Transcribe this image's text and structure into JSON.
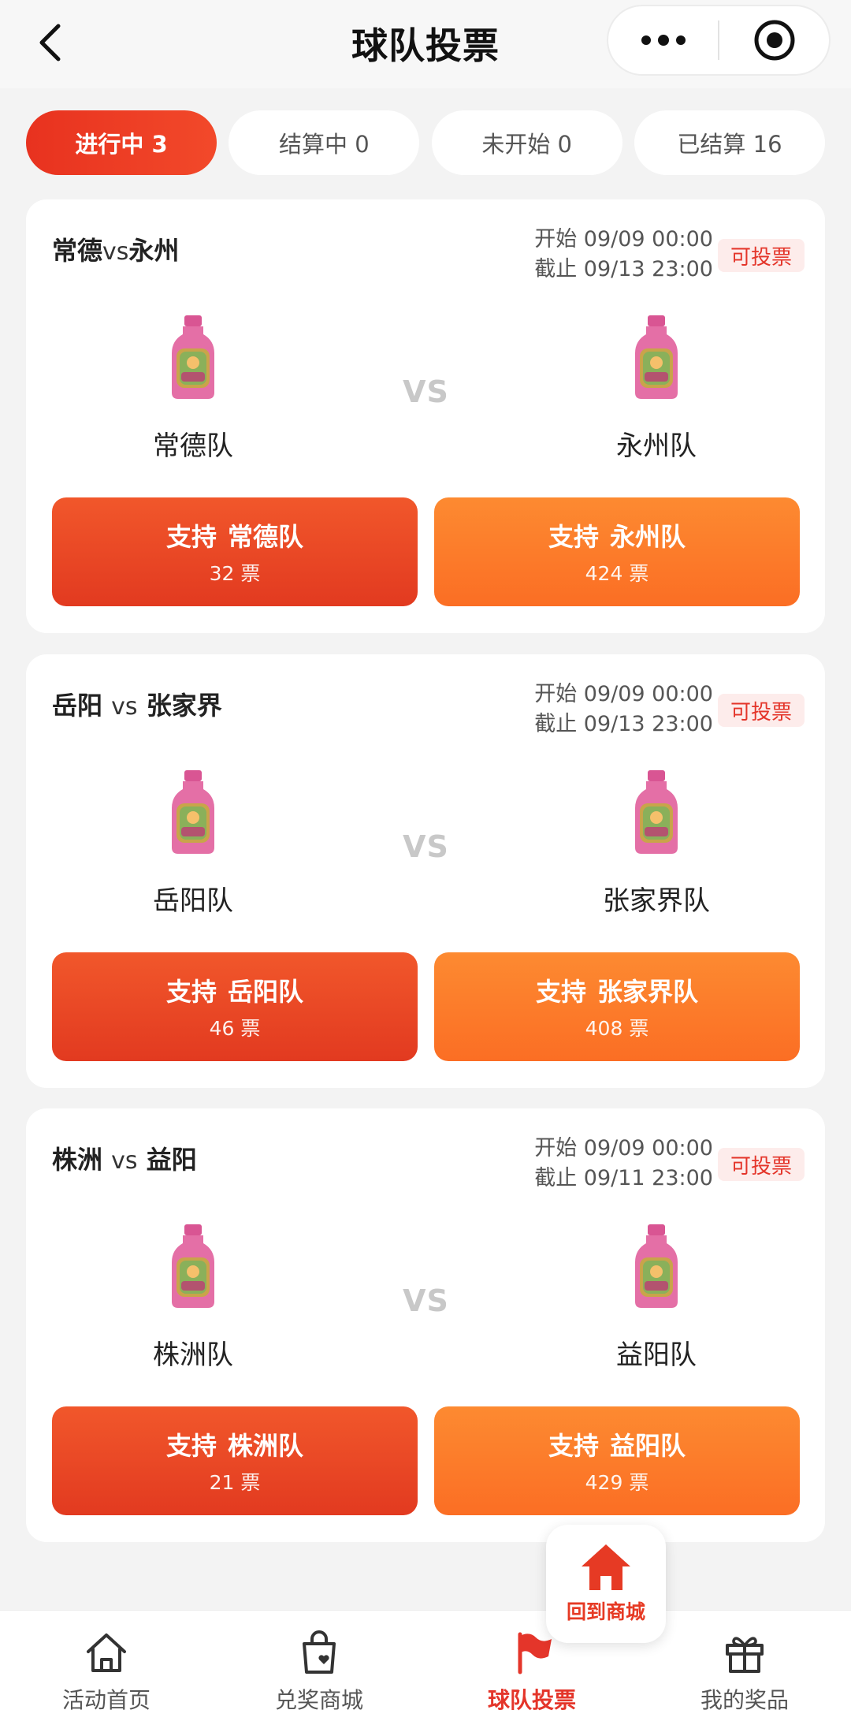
{
  "header": {
    "title": "球队投票"
  },
  "tabs": [
    {
      "label": "进行中 3",
      "active": true
    },
    {
      "label": "结算中 0",
      "active": false
    },
    {
      "label": "未开始 0",
      "active": false
    },
    {
      "label": "已结算 16",
      "active": false
    }
  ],
  "matches": [
    {
      "home": "常德",
      "vs": "vs",
      "away": "永州",
      "start": "开始 09/09 00:00",
      "end": "截止 09/13 23:00",
      "status": "可投票",
      "left_team": "常德队",
      "right_team": "永州队",
      "vs_label": "VS",
      "support_word": "支持",
      "left_votes": "32 票",
      "right_votes": "424 票"
    },
    {
      "home": "岳阳",
      "vs": "vs",
      "away": "张家界",
      "start": "开始 09/09 00:00",
      "end": "截止 09/13 23:00",
      "status": "可投票",
      "left_team": "岳阳队",
      "right_team": "张家界队",
      "vs_label": "VS",
      "support_word": "支持",
      "left_votes": "46 票",
      "right_votes": "408 票"
    },
    {
      "home": "株洲",
      "vs": "vs",
      "away": "益阳",
      "start": "开始 09/09 00:00",
      "end": "截止 09/11 23:00",
      "status": "可投票",
      "left_team": "株洲队",
      "right_team": "益阳队",
      "vs_label": "VS",
      "support_word": "支持",
      "left_votes": "21 票",
      "right_votes": "429 票"
    }
  ],
  "float_button": {
    "label": "回到商城",
    "icon": "home-icon"
  },
  "bottom_nav": [
    {
      "label": "活动首页",
      "icon": "home-outline-icon",
      "active": false
    },
    {
      "label": "兑奖商城",
      "icon": "shopping-bag-heart-icon",
      "active": false
    },
    {
      "label": "球队投票",
      "icon": "flag-icon",
      "active": true
    },
    {
      "label": "我的奖品",
      "icon": "gift-icon",
      "active": false
    }
  ],
  "colors": {
    "accent_red": "#e4352a",
    "accent_orange": "#fd8a31",
    "badge_bg": "#fdeceb",
    "bottle_pink": "#e46fa6"
  }
}
